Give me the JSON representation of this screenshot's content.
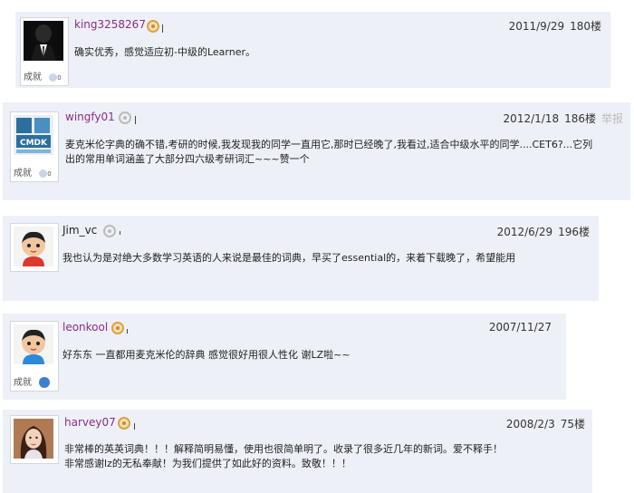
{
  "posts": [
    {
      "username": "king3258267",
      "date": "2011/9/29",
      "floor": "180楼",
      "achievement": "成就",
      "achievement_count": "0",
      "text": "确实优秀，感觉适应初-中级的Learner。"
    },
    {
      "username": "wingfy01",
      "date": "2012/1/18",
      "floor": "186楼",
      "reply": "举报",
      "achievement": "成就",
      "achievement_count": "0",
      "avatar_text": "CMDK",
      "text_line1": "麦克米伦字典的确不错,考研的时候,我发现我的同学一直用它,那时已经晚了,我看过,适合中级水平的同学....CET6?...它列",
      "text_line2": "出的常用单词涵盖了大部分四六级考研词汇~~~赞一个"
    },
    {
      "username": "Jim_vc",
      "date": "2012/6/29",
      "floor": "196楼",
      "text": "我也认为是对绝大多数学习英语的人来说是最佳的词典，早买了essential的，来着下载晚了，希望能用"
    },
    {
      "username": "leonkool",
      "date": "2007/11/27",
      "achievement": "成就",
      "text": "好东东 一直都用麦克米伦的辞典 感觉很好用很人性化 谢LZ啦~~"
    },
    {
      "username": "harvey07",
      "date": "2008/2/3",
      "floor": "75楼",
      "text_line1": "非常棒的英英词典！！！解释简明易懂，使用也很简单明了。收录了很多近几年的新词。爱不释手！",
      "text_line2": "非常感谢lz的无私奉献！为我们提供了如此好的资料。致敬！！！"
    }
  ],
  "colors": {
    "username": "#8b2d86",
    "post_bg": "#eef0f7"
  }
}
